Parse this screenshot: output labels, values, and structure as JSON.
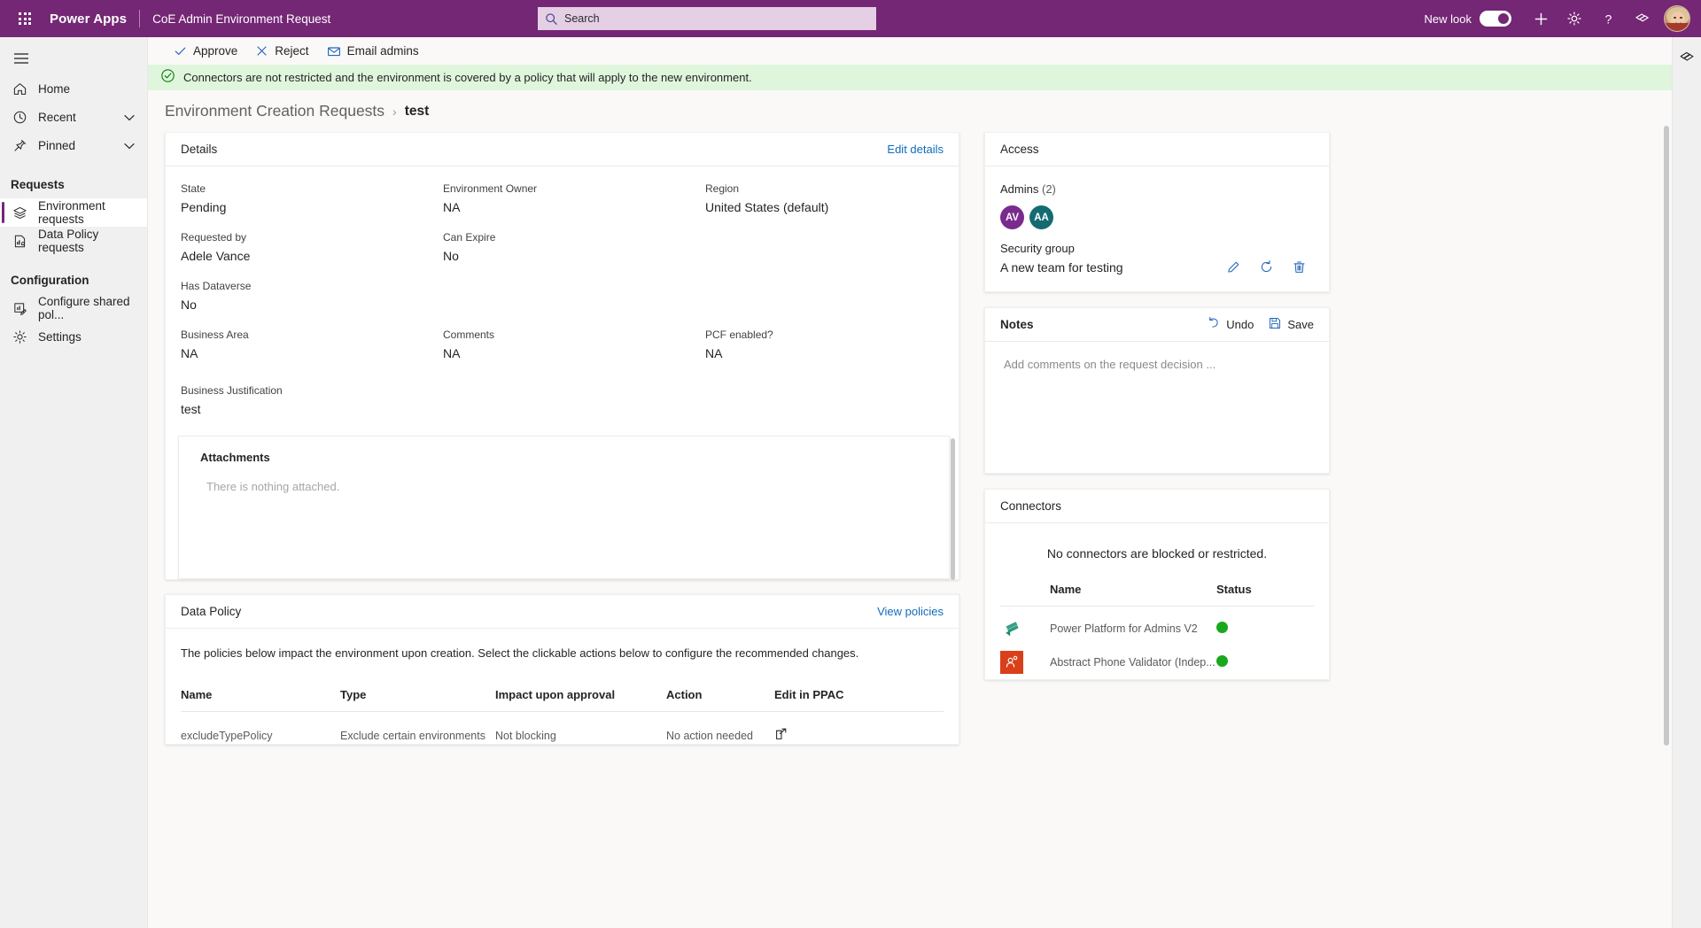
{
  "topbar": {
    "waffle_icon": "app-launcher-icon",
    "brand": "Power Apps",
    "app_title": "CoE Admin Environment Request",
    "search_placeholder": "Search",
    "new_look_label": "New look",
    "new_look_on": true,
    "icons": [
      "plus-icon",
      "gear-icon",
      "help-icon",
      "feedback-icon"
    ],
    "avatar_name": "user-avatar"
  },
  "sidebar": {
    "hamburger": "hamburger-icon",
    "items": [
      {
        "label": "Home",
        "icon": "home-icon",
        "expandable": false,
        "selected": false
      },
      {
        "label": "Recent",
        "icon": "clock-icon",
        "expandable": true,
        "selected": false
      },
      {
        "label": "Pinned",
        "icon": "pin-icon",
        "expandable": true,
        "selected": false
      }
    ],
    "groups": [
      {
        "title": "Requests",
        "items": [
          {
            "label": "Environment requests",
            "icon": "layers-icon",
            "selected": true
          },
          {
            "label": "Data Policy requests",
            "icon": "policy-doc-icon",
            "selected": false
          }
        ]
      },
      {
        "title": "Configuration",
        "items": [
          {
            "label": "Configure shared pol...",
            "icon": "configure-policy-icon",
            "selected": false
          },
          {
            "label": "Settings",
            "icon": "gear-icon",
            "selected": false
          }
        ]
      }
    ]
  },
  "commandbar": {
    "approve": "Approve",
    "reject": "Reject",
    "email_admins": "Email admins"
  },
  "banner": {
    "icon": "success-check-icon",
    "text": "Connectors are not restricted and the environment is covered by a policy that will apply to the new environment.",
    "background": "#dff6dd"
  },
  "breadcrumb": {
    "parent": "Environment Creation Requests",
    "separator": "›",
    "current": "test"
  },
  "details": {
    "title": "Details",
    "edit_link": "Edit details",
    "fields": [
      {
        "label": "State",
        "value": "Pending"
      },
      {
        "label": "Environment Owner",
        "value": "NA"
      },
      {
        "label": "Region",
        "value": "United States (default)"
      },
      {
        "label": "Requested by",
        "value": "Adele Vance"
      },
      {
        "label": "Can Expire",
        "value": "No"
      },
      {
        "label": "",
        "value": ""
      },
      {
        "label": "Has Dataverse",
        "value": "No"
      },
      {
        "label": "",
        "value": ""
      },
      {
        "label": "",
        "value": ""
      },
      {
        "label": "Business Area",
        "value": "NA"
      },
      {
        "label": "Comments",
        "value": "NA"
      },
      {
        "label": "PCF enabled?",
        "value": "NA"
      }
    ],
    "justification_label": "Business Justification",
    "justification_value": "test",
    "attachments_title": "Attachments",
    "attachments_empty": "There is nothing attached."
  },
  "data_policy": {
    "title": "Data Policy",
    "view_link": "View policies",
    "note": "The policies below impact the environment upon creation. Select the clickable actions below to configure the recommended changes.",
    "columns": [
      "Name",
      "Type",
      "Impact upon approval",
      "Action",
      "Edit in PPAC"
    ],
    "rows": [
      {
        "name": "excludeTypePolicy",
        "type": "Exclude certain environments",
        "impact": "Not blocking",
        "action": "No action needed",
        "edit_icon": "open-in-new-icon"
      }
    ]
  },
  "access": {
    "title": "Access",
    "admins_label": "Admins",
    "admins_count": "(2)",
    "admins": [
      {
        "initials": "AV",
        "color": "#7a2b8f"
      },
      {
        "initials": "AA",
        "color": "#146b72"
      }
    ],
    "security_group_label": "Security group",
    "security_group_value": "A new team for testing",
    "actions": [
      "edit-pencil-icon",
      "refresh-icon",
      "delete-trash-icon"
    ]
  },
  "notes": {
    "title": "Notes",
    "undo_label": "Undo",
    "save_label": "Save",
    "undo_icon": "undo-arrow-icon",
    "save_icon": "save-disk-icon",
    "placeholder": "Add comments on the request decision ...",
    "value": ""
  },
  "connectors": {
    "title": "Connectors",
    "note": "No connectors are blocked or restricted.",
    "columns": [
      "Name",
      "Status"
    ],
    "rows": [
      {
        "name": "Power Platform for Admins V2",
        "status_color": "#17a91b",
        "icon": "power-platform-icon"
      },
      {
        "name": "Abstract Phone Validator (Indep...",
        "status_color": "#17a91b",
        "icon": "abstract-phone-validator-icon"
      }
    ]
  },
  "right_rail": {
    "icon": "copilot-icon"
  },
  "theme": {
    "brand_purple": "#742774",
    "link_blue": "#0f6cbd",
    "success_green": "#17a91b"
  }
}
